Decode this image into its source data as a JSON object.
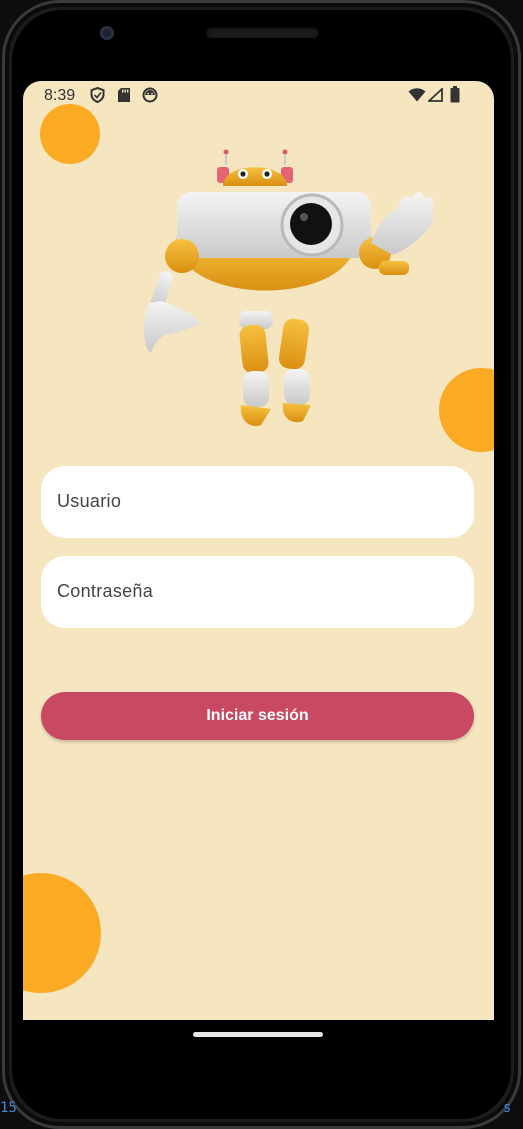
{
  "status_bar": {
    "time": "8:39",
    "left_icons": [
      "shield-icon",
      "sd-card-icon",
      "android-icon"
    ],
    "right_icons": [
      "wifi-icon",
      "signal-icon",
      "battery-icon"
    ]
  },
  "illustration": {
    "name": "waving-robot",
    "description_icon": "robot-icon"
  },
  "form": {
    "username_placeholder": "Usuario",
    "password_placeholder": "Contraseña",
    "login_label": "Iniciar sesión"
  },
  "theme": {
    "background": "#f5e6c0",
    "accent_circle": "#fbaa24",
    "button": "#c94862",
    "field": "#ffffff"
  },
  "edge": {
    "left": "15",
    "right": "s"
  }
}
